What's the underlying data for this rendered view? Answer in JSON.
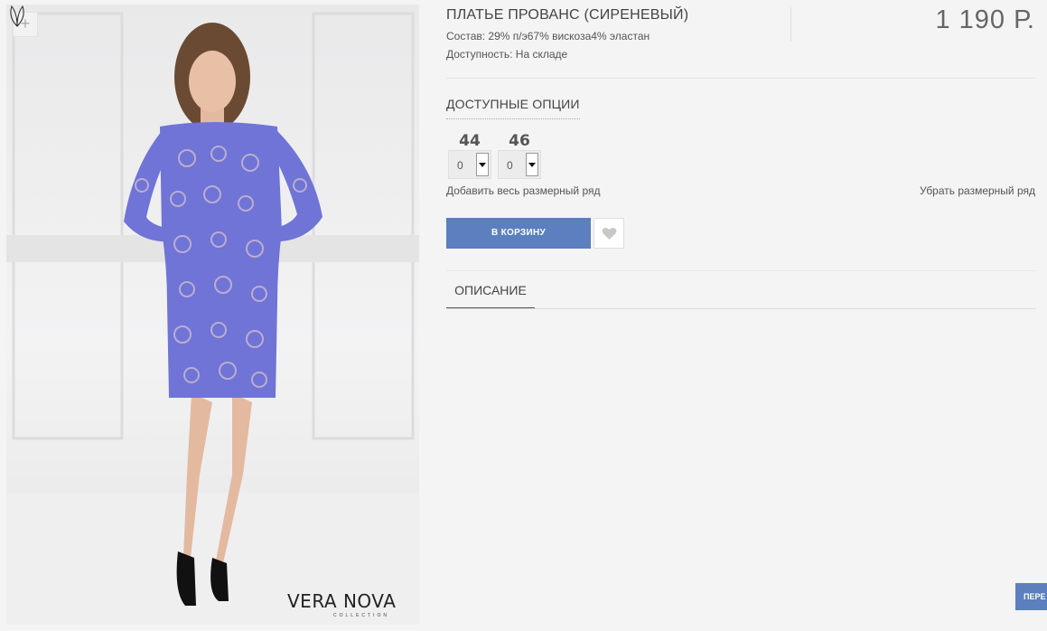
{
  "product": {
    "title": "ПЛАТЬЕ ПРОВАНС (СИРЕНЕВЫЙ)",
    "composition": "Состав: 29% п/э67% вискоза4% эластан",
    "availability": "Доступность: На складе",
    "price": "1 190 Р."
  },
  "image": {
    "zoom_label": "+",
    "brand_name": "VERA NOVA",
    "brand_sub": "COLLECTION",
    "dress_color": "#6f74d6"
  },
  "options": {
    "title": "ДОСТУПНЫЕ ОПЦИИ",
    "sizes": [
      {
        "size": "44",
        "qty": "0"
      },
      {
        "size": "46",
        "qty": "0"
      }
    ],
    "add_all_label": "Добавить весь размерный ряд",
    "remove_all_label": "Убрать размерный ряд"
  },
  "actions": {
    "cart_label": "В КОРЗИНУ",
    "favorite_icon": "heart-icon",
    "next_label": "ПЕРЕ"
  },
  "tabs": [
    {
      "label": "ОПИСАНИЕ",
      "active": true
    }
  ],
  "colors": {
    "accent": "#5b7fbf",
    "background": "#f4f4f4"
  }
}
